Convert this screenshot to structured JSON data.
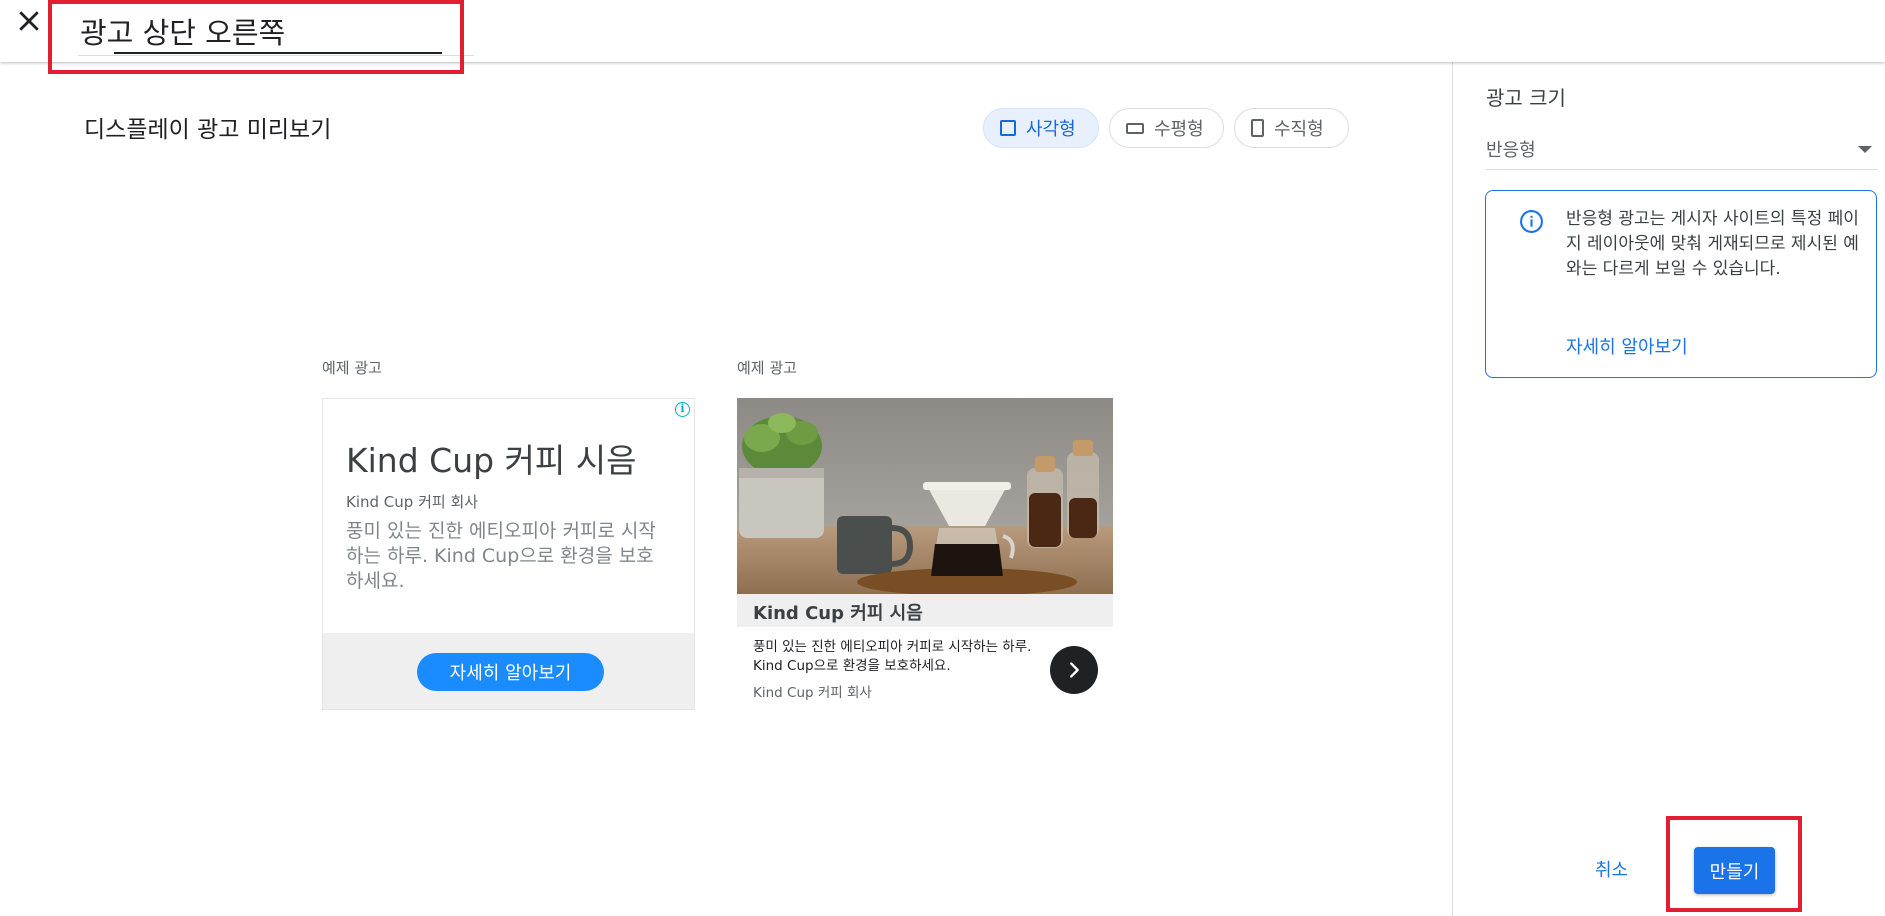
{
  "header": {
    "close_icon": "close-icon",
    "ad_name_value": "광고 상단 오른쪽"
  },
  "preview": {
    "title": "디스플레이 광고 미리보기",
    "toggles": [
      {
        "label": "사각형",
        "icon": "square-icon",
        "active": true
      },
      {
        "label": "수평형",
        "icon": "horizontal-rect-icon",
        "active": false
      },
      {
        "label": "수직형",
        "icon": "vertical-rect-icon",
        "active": false
      }
    ],
    "samples": [
      {
        "label": "예제 광고",
        "headline": "Kind Cup 커피 시음",
        "advertiser": "Kind Cup 커피 회사",
        "description": "풍미 있는 진한 에티오피아 커피로 시작하는 하루. Kind Cup으로 환경을 보호하세요.",
        "cta": "자세히 알아보기",
        "badge_icon": "info-icon"
      },
      {
        "label": "예제 광고",
        "headline": "Kind Cup 커피 시음",
        "description": "풍미 있는 진한 에티오피아 커피로 시작하는 하루. Kind Cup으로 환경을 보호하세요.",
        "advertiser": "Kind Cup 커피 회사",
        "next_icon": "chevron-right-icon"
      }
    ]
  },
  "sidepanel": {
    "size_label": "광고 크기",
    "size_value": "반응형",
    "info_message": "반응형 광고는 게시자 사이트의 특정 페이지 레이아웃에 맞춰 게재되므로 제시된 예와는 다르게 보일 수 있습니다.",
    "learn_more": "자세히 알아보기",
    "cancel": "취소",
    "create": "만들기"
  },
  "colors": {
    "primary": "#1a73e8",
    "highlight_box": "#e02030",
    "cta_blue": "#1a8cff"
  }
}
